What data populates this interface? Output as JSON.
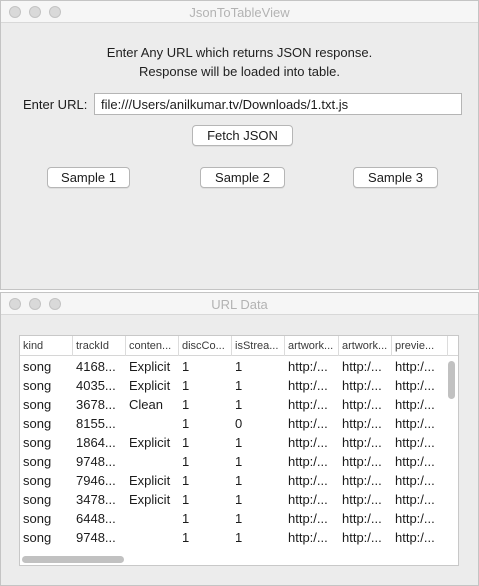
{
  "main_window": {
    "title": "JsonToTableView",
    "instruction_line1": "Enter Any URL which returns JSON response.",
    "instruction_line2": "Response will be loaded into table.",
    "url_label": "Enter URL:",
    "url_value": "file:///Users/anilkumar.tv/Downloads/1.txt.js",
    "fetch_button": "Fetch JSON",
    "sample_buttons": [
      "Sample 1",
      "Sample 2",
      "Sample 3"
    ]
  },
  "data_window": {
    "title": "URL Data",
    "columns": [
      "kind",
      "trackId",
      "conten...",
      "discCo...",
      "isStrea...",
      "artwork...",
      "artwork...",
      "previe..."
    ],
    "rows": [
      [
        "song",
        "4168...",
        "Explicit",
        "1",
        "1",
        "http:/...",
        "http:/...",
        "http:/..."
      ],
      [
        "song",
        "4035...",
        "Explicit",
        "1",
        "1",
        "http:/...",
        "http:/...",
        "http:/..."
      ],
      [
        "song",
        "3678...",
        "Clean",
        "1",
        "1",
        "http:/...",
        "http:/...",
        "http:/..."
      ],
      [
        "song",
        "8155...",
        "",
        "1",
        "0",
        "http:/...",
        "http:/...",
        "http:/..."
      ],
      [
        "song",
        "1864...",
        "Explicit",
        "1",
        "1",
        "http:/...",
        "http:/...",
        "http:/..."
      ],
      [
        "song",
        "9748...",
        "",
        "1",
        "1",
        "http:/...",
        "http:/...",
        "http:/..."
      ],
      [
        "song",
        "7946...",
        "Explicit",
        "1",
        "1",
        "http:/...",
        "http:/...",
        "http:/..."
      ],
      [
        "song",
        "3478...",
        "Explicit",
        "1",
        "1",
        "http:/...",
        "http:/...",
        "http:/..."
      ],
      [
        "song",
        "6448...",
        "",
        "1",
        "1",
        "http:/...",
        "http:/...",
        "http:/..."
      ],
      [
        "song",
        "9748...",
        "",
        "1",
        "1",
        "http:/...",
        "http:/...",
        "http:/..."
      ]
    ]
  }
}
